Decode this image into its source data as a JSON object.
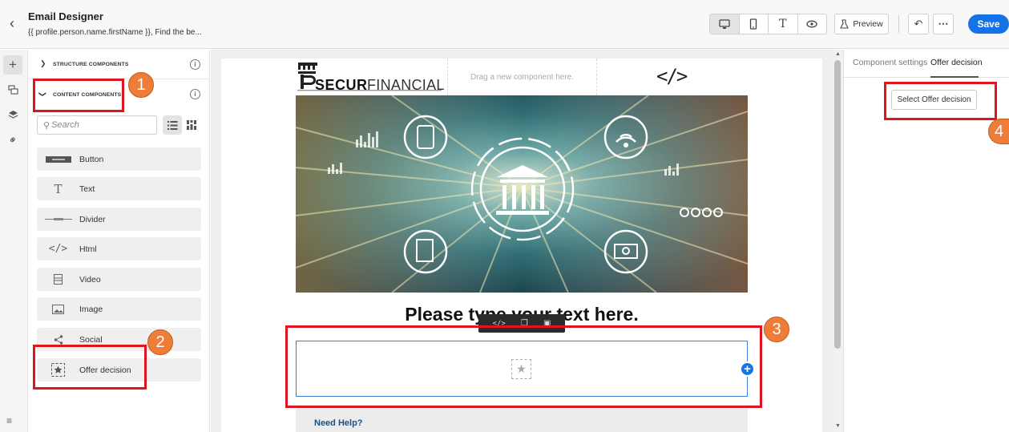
{
  "header": {
    "back_icon": "chevron-left-icon",
    "title": "Email Designer",
    "subtitle": "{{ profile.person.name.firstName }}, Find the be...",
    "preview_label": "Preview",
    "save_label": "Save",
    "view_toggles": [
      "desktop-icon",
      "mobile-icon",
      "text-icon",
      "eye-icon"
    ]
  },
  "rail": {
    "items": [
      "plus-icon",
      "fragments-icon",
      "layers-icon",
      "link-icon"
    ],
    "bottom_icon": "layers-toggle-icon"
  },
  "left_panel": {
    "structure_label": "STRUCTURE COMPONENTS",
    "content_label": "CONTENT COMPONENTS",
    "search_placeholder": "Search",
    "items": [
      {
        "label": "Button",
        "icon": "button-icon"
      },
      {
        "label": "Text",
        "icon": "text-icon"
      },
      {
        "label": "Divider",
        "icon": "divider-icon"
      },
      {
        "label": "Html",
        "icon": "code-icon"
      },
      {
        "label": "Video",
        "icon": "video-icon"
      },
      {
        "label": "Image",
        "icon": "image-icon"
      },
      {
        "label": "Social",
        "icon": "share-icon"
      },
      {
        "label": "Offer decision",
        "icon": "offer-decision-icon"
      }
    ]
  },
  "canvas": {
    "logo_text_bold": "SECUR",
    "logo_text_light": "FINANCIAL",
    "drag_placeholder": "Drag a new component here.",
    "code_symbol": "</>",
    "heading": "Please type your text here.",
    "footer_text": "Need Help?"
  },
  "right_panel": {
    "tabs": [
      "Component settings",
      "Offer decision"
    ],
    "active_tab": "Offer decision",
    "select_button": "Select Offer decision"
  },
  "annotations": {
    "badges": [
      "1",
      "2",
      "3",
      "4"
    ],
    "highlight_color": "#e0141e",
    "badge_color": "#ee7d3a"
  },
  "colors": {
    "accent": "#1473e6",
    "selection": "#3a7fd5"
  }
}
